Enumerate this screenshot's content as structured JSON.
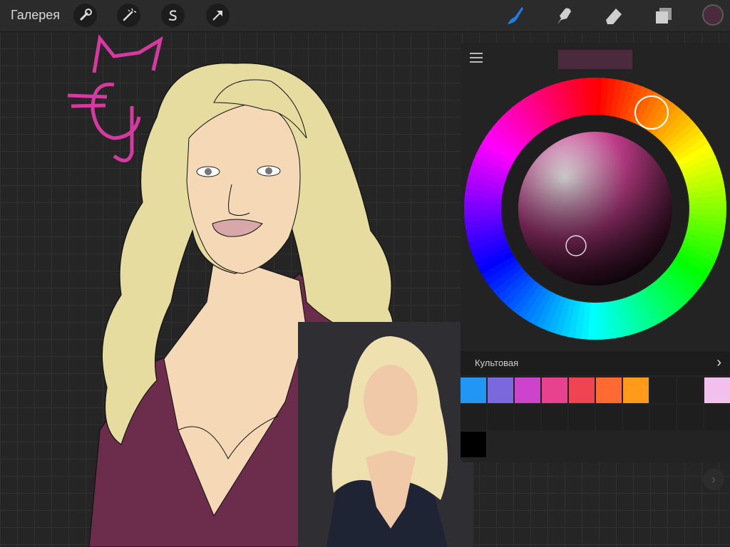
{
  "topbar": {
    "gallery_label": "Галерея",
    "left_tools": [
      {
        "name": "actions",
        "icon": "wrench-icon"
      },
      {
        "name": "adjustments",
        "icon": "magic-wand-icon"
      },
      {
        "name": "selection",
        "icon": "selection-s-icon"
      },
      {
        "name": "transform",
        "icon": "arrow-cursor-icon"
      }
    ],
    "right_tools": [
      {
        "name": "brush",
        "icon": "brush-icon",
        "active": true
      },
      {
        "name": "smudge",
        "icon": "smudge-icon",
        "active": false
      },
      {
        "name": "eraser",
        "icon": "eraser-icon",
        "active": false
      },
      {
        "name": "layers",
        "icon": "layers-icon",
        "active": false
      }
    ],
    "current_color": "#4a2a3c"
  },
  "color_panel": {
    "current_color": "#4a2a3c",
    "palette_name": "Культовая",
    "palette_colors": [
      "#2196f3",
      "#7b68dd",
      "#cc44cc",
      "#e8418e",
      "#f04455",
      "#ff6a33",
      "#ff9a1a",
      "",
      "",
      "#f2c0ec",
      "",
      "",
      "",
      "",
      "",
      "",
      "",
      "",
      "",
      "",
      "#000000"
    ]
  },
  "colors": {
    "brush_active": "#1e7ee6",
    "shirt": "#6b2d4b",
    "hair": "#e6dca0",
    "skin": "#f5d8b5"
  }
}
